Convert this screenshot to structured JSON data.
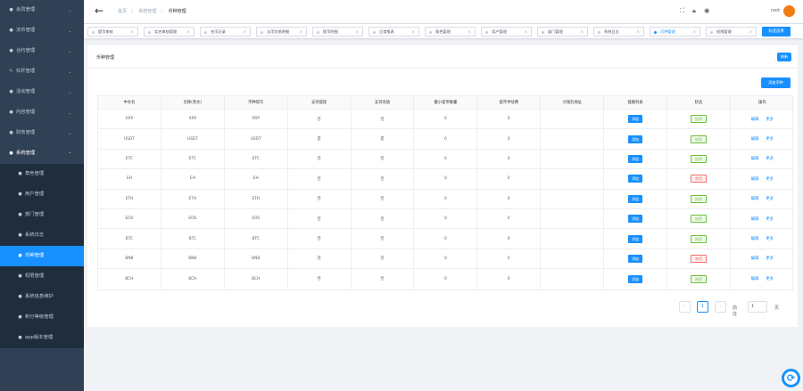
{
  "sidebar": {
    "items": [
      {
        "label": "会员管理",
        "icon": "eye-icon"
      },
      {
        "label": "法币管理",
        "icon": "gear-icon"
      },
      {
        "label": "合约管理",
        "icon": "coin-icon"
      },
      {
        "label": "杠杆管理",
        "icon": "wrench-icon"
      },
      {
        "label": "活动管理",
        "icon": "flag-icon"
      },
      {
        "label": "内容管理",
        "icon": "document-icon"
      },
      {
        "label": "财务管理",
        "icon": "wallet-icon"
      },
      {
        "label": "系统管理",
        "icon": "settings-icon"
      }
    ],
    "subitems": [
      {
        "label": "角色管理"
      },
      {
        "label": "用户管理"
      },
      {
        "label": "部门管理"
      },
      {
        "label": "系统日志"
      },
      {
        "label": "币种管理",
        "active": true
      },
      {
        "label": "权限管理"
      },
      {
        "label": "系统信息维护"
      },
      {
        "label": "积分等级管理"
      },
      {
        "label": "app版本管理"
      }
    ]
  },
  "navbar": {
    "crumbs": [
      "首页",
      "系统管理",
      "币种管理"
    ],
    "user": "root"
  },
  "tags": [
    {
      "label": "提币审核"
    },
    {
      "label": "实名审核管理"
    },
    {
      "label": "充币记录"
    },
    {
      "label": "法币交易明细"
    },
    {
      "label": "提币明细"
    },
    {
      "label": "日常报表"
    },
    {
      "label": "角色管理"
    },
    {
      "label": "用户管理"
    },
    {
      "label": "部门管理"
    },
    {
      "label": "系统日志"
    },
    {
      "label": "币种管理",
      "active": true
    },
    {
      "label": "权限管理"
    }
  ],
  "tags_button": "标签选项",
  "card": {
    "title": "币种管理",
    "refresh": "刷新",
    "add": "添加币种"
  },
  "table": {
    "columns": [
      "中文名",
      "名称(英文)",
      "币种简写",
      "支持提现",
      "支持充值",
      "最小提币数量",
      "提币手续费",
      "冷钱包地址",
      "链路列表",
      "状态",
      "操作"
    ],
    "rows": [
      [
        "XRP",
        "XRP",
        "XRP",
        "否",
        "否",
        "0",
        "0",
        "",
        "添加",
        "启用",
        "编辑",
        "更多"
      ],
      [
        "USDT",
        "USDT",
        "USDT",
        "是",
        "是",
        "0",
        "0",
        "",
        "添加",
        "启用",
        "编辑",
        "更多"
      ],
      [
        "ETC",
        "ETC",
        "ETC",
        "否",
        "否",
        "0",
        "0",
        "",
        "添加",
        "启用",
        "编辑",
        "更多"
      ],
      [
        "EH",
        "EH",
        "EH",
        "否",
        "否",
        "0",
        "0",
        "",
        "添加",
        "禁用",
        "编辑",
        "更多"
      ],
      [
        "ETH",
        "ETH",
        "ETH",
        "否",
        "否",
        "0",
        "0",
        "",
        "添加",
        "启用",
        "编辑",
        "更多"
      ],
      [
        "EOS",
        "EOS",
        "EOS",
        "否",
        "否",
        "0",
        "0",
        "",
        "添加",
        "启用",
        "编辑",
        "更多"
      ],
      [
        "BTC",
        "BTC",
        "BTC",
        "否",
        "否",
        "0",
        "0",
        "",
        "添加",
        "启用",
        "编辑",
        "更多"
      ],
      [
        "BNB",
        "BNB",
        "BNB",
        "否",
        "否",
        "0",
        "0",
        "",
        "添加",
        "禁用",
        "编辑",
        "更多"
      ],
      [
        "BCH",
        "BCH",
        "BCH",
        "否",
        "否",
        "0",
        "0",
        "",
        "添加",
        "启用",
        "编辑",
        "更多"
      ]
    ]
  },
  "pager": {
    "page": "1",
    "goto_label": "前往",
    "goto_value": "1",
    "unit": "页"
  }
}
